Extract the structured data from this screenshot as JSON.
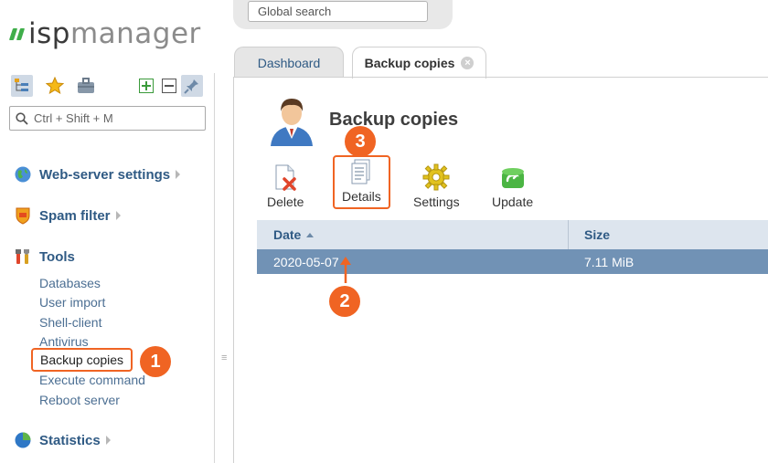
{
  "brand": {
    "logo_text_bold": "isp",
    "logo_text_light": "manager"
  },
  "sidebar": {
    "toolbar_icons": [
      "tree-view-icon",
      "star-icon",
      "briefcase-icon",
      "expand-all-icon",
      "collapse-all-icon",
      "pin-icon"
    ],
    "search_placeholder": "Ctrl + Shift + M",
    "groups": [
      {
        "label": "Web-server settings",
        "icon": "globe-icon"
      },
      {
        "label": "Spam filter",
        "icon": "shield-icon"
      },
      {
        "label": "Tools",
        "icon": "tools-icon"
      },
      {
        "label": "Statistics",
        "icon": "pie-chart-icon"
      }
    ],
    "tools_items": [
      "Databases",
      "User import",
      "Shell-client",
      "Antivirus",
      "Backup copies",
      "Execute command",
      "Reboot server"
    ],
    "selected_item": "Backup copies"
  },
  "header": {
    "global_search_placeholder": "Global search"
  },
  "tabs": [
    {
      "label": "Dashboard",
      "active": false
    },
    {
      "label": "Backup copies",
      "active": true,
      "closable": true
    }
  ],
  "page": {
    "title": "Backup copies",
    "toolbar": [
      {
        "label": "Delete",
        "icon": "delete-icon"
      },
      {
        "label": "Details",
        "icon": "details-icon"
      },
      {
        "label": "Settings",
        "icon": "gear-icon"
      },
      {
        "label": "Update",
        "icon": "refresh-icon"
      }
    ]
  },
  "table": {
    "columns": [
      "Date",
      "Size"
    ],
    "sort": {
      "column": "Date",
      "direction": "ascending"
    },
    "rows": [
      {
        "date": "2020-05-07",
        "size": "7.11 MiB",
        "selected": true
      }
    ]
  },
  "annotations": [
    "1",
    "2",
    "3"
  ],
  "colors": {
    "accent": "#f06423",
    "selected_row": "#7192b5",
    "link": "#2f5a84",
    "brand_green": "#3fae4a"
  }
}
